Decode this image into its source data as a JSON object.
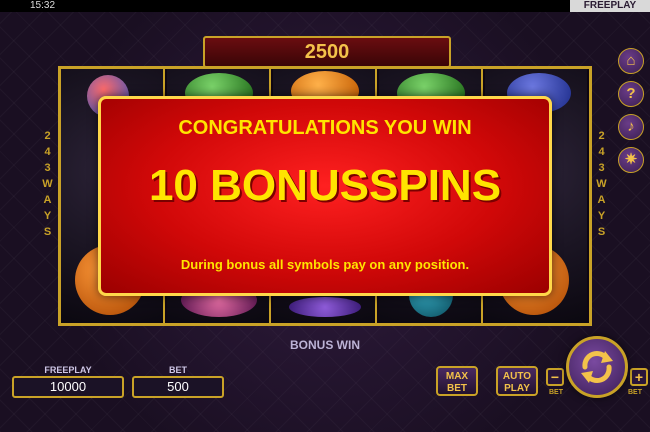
{
  "status_bar": {
    "time": "15:32",
    "mode": "FREEPLAY"
  },
  "win_display": {
    "value": "2500"
  },
  "ways": {
    "left": [
      "2",
      "4",
      "3",
      "W",
      "A",
      "Y",
      "S"
    ],
    "right": [
      "2",
      "4",
      "3",
      "W",
      "A",
      "Y",
      "S"
    ]
  },
  "dialog": {
    "title": "CONGRATULATIONS YOU WIN",
    "headline": "10 BONUSSPINS",
    "note": "During bonus all symbols pay on any position."
  },
  "bonus_win_label": "BONUS WIN",
  "freeplay": {
    "label": "FREEPLAY",
    "value": "10000"
  },
  "bet": {
    "label": "BET",
    "value": "500"
  },
  "buttons": {
    "max_bet": [
      "MAX",
      "BET"
    ],
    "auto_play": [
      "AUTO",
      "PLAY"
    ],
    "minus": "−",
    "plus": "+",
    "bet_tag": "BET"
  },
  "side_icons": [
    "home-icon",
    "help-icon",
    "sound-icon",
    "settings-icon"
  ],
  "colors": {
    "gold": "#c9a227",
    "dialog_red": "#d00808",
    "dialog_text": "#ffe500"
  }
}
